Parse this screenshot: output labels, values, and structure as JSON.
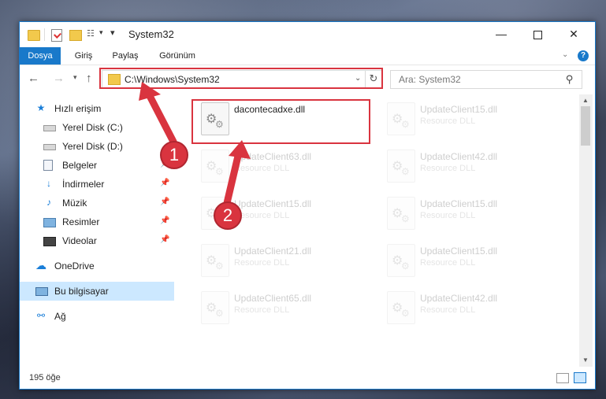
{
  "window": {
    "title": "System32",
    "controls": {
      "minimize": "—",
      "maximize": "",
      "close": "✕"
    }
  },
  "ribbon": {
    "tabs": [
      "Dosya",
      "Giriş",
      "Paylaş",
      "Görünüm"
    ],
    "help": "?"
  },
  "address": {
    "path": "C:\\Windows\\System32",
    "search_placeholder": "Ara: System32"
  },
  "sidebar": {
    "items": [
      {
        "label": "Hızlı erişim",
        "icon": "star-icon",
        "pinned": false
      },
      {
        "label": "Yerel Disk (C:)",
        "icon": "drive-icon",
        "pinned": false
      },
      {
        "label": "Yerel Disk (D:)",
        "icon": "drive-icon",
        "pinned": false
      },
      {
        "label": "Belgeler",
        "icon": "documents-icon",
        "pinned": true
      },
      {
        "label": "İndirmeler",
        "icon": "download-icon",
        "pinned": true
      },
      {
        "label": "Müzik",
        "icon": "music-icon",
        "pinned": true
      },
      {
        "label": "Resimler",
        "icon": "pictures-icon",
        "pinned": true
      },
      {
        "label": "Videolar",
        "icon": "videos-icon",
        "pinned": true
      },
      {
        "label": "OneDrive",
        "icon": "cloud-icon",
        "pinned": false
      },
      {
        "label": "Bu bilgisayar",
        "icon": "computer-icon",
        "pinned": false,
        "selected": true
      },
      {
        "label": "Ağ",
        "icon": "network-icon",
        "pinned": false
      }
    ]
  },
  "files": [
    {
      "name": "dacontecadxe.dll",
      "type": "",
      "highlighted": true
    },
    {
      "name": "UpdateClient15.dll",
      "type": "Resource DLL"
    },
    {
      "name": "UpdateClient63.dll",
      "type": "Resource DLL"
    },
    {
      "name": "UpdateClient42.dll",
      "type": "Resource DLL"
    },
    {
      "name": "UpdateClient15.dll",
      "type": "Resource DLL"
    },
    {
      "name": "UpdateClient15.dll",
      "type": "Resource DLL"
    },
    {
      "name": "UpdateClient21.dll",
      "type": "Resource DLL"
    },
    {
      "name": "UpdateClient15.dll",
      "type": "Resource DLL"
    },
    {
      "name": "UpdateClient65.dll",
      "type": "Resource DLL"
    },
    {
      "name": "UpdateClient42.dll",
      "type": "Resource DLL"
    }
  ],
  "status": {
    "count": "195 öğe"
  },
  "annotations": {
    "badge1": "1",
    "badge2": "2",
    "color": "#d9343f"
  },
  "colors": {
    "accent": "#1979ca",
    "selection": "#cce8ff"
  }
}
